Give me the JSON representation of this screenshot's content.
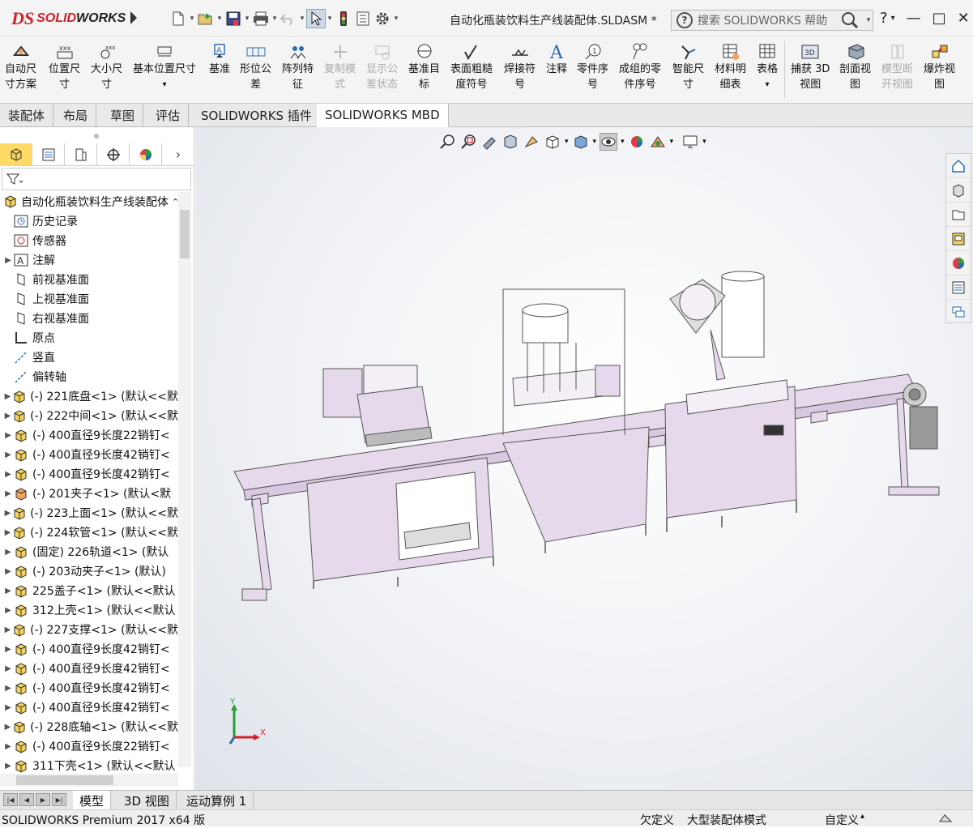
{
  "app": {
    "logo_prefix": "DS",
    "logo_text_red": "SOLID",
    "logo_text_dark": "WORKS"
  },
  "title": "自动化瓶装饮料生产线装配体.SLDASM *",
  "search": {
    "placeholder": "搜索 SOLIDWORKS 帮助"
  },
  "window_controls": {
    "help": "?",
    "minimize": "—",
    "maximize": "□",
    "close": "✕"
  },
  "commands": [
    {
      "label1": "自动尺",
      "label2": "寸方案",
      "icon": "auto-dimension-icon",
      "enabled": true
    },
    {
      "label1": "位置尺",
      "label2": "寸",
      "icon": "location-dimension-icon",
      "enabled": true
    },
    {
      "label1": "大小尺",
      "label2": "寸",
      "icon": "size-dimension-icon",
      "enabled": true
    },
    {
      "label1": "基本位置尺寸",
      "label2": "",
      "icon": "basic-location-dimension-icon",
      "enabled": true
    },
    {
      "label1": "基准",
      "label2": "",
      "icon": "datum-icon",
      "enabled": true
    },
    {
      "label1": "形位公",
      "label2": "差",
      "icon": "geometric-tolerance-icon",
      "enabled": true
    },
    {
      "label1": "阵列特",
      "label2": "征",
      "icon": "pattern-feature-icon",
      "enabled": true
    },
    {
      "label1": "复制模",
      "label2": "式",
      "icon": "copy-scheme-icon",
      "enabled": false
    },
    {
      "label1": "显示公",
      "label2": "差状态",
      "icon": "show-tolerance-status-icon",
      "enabled": false
    },
    {
      "label1": "基准目",
      "label2": "标",
      "icon": "datum-target-icon",
      "enabled": true
    },
    {
      "label1": "表面粗糙",
      "label2": "度符号",
      "icon": "surface-finish-icon",
      "enabled": true
    },
    {
      "label1": "焊接符",
      "label2": "号",
      "icon": "weld-symbol-icon",
      "enabled": true
    },
    {
      "label1": "注释",
      "label2": "",
      "icon": "note-icon",
      "enabled": true
    },
    {
      "label1": "零件序",
      "label2": "号",
      "icon": "balloon-icon",
      "enabled": true
    },
    {
      "label1": "成组的零",
      "label2": "件序号",
      "icon": "stacked-balloon-icon",
      "enabled": true
    },
    {
      "label1": "智能尺",
      "label2": "寸",
      "icon": "smart-dimension-icon",
      "enabled": true
    },
    {
      "label1": "材料明",
      "label2": "细表",
      "icon": "bom-icon",
      "enabled": true
    },
    {
      "label1": "表格",
      "label2": "",
      "icon": "table-icon",
      "enabled": true
    },
    {
      "label1": "捕获 3D",
      "label2": "视图",
      "icon": "capture-3d-view-icon",
      "enabled": true
    },
    {
      "label1": "剖面视",
      "label2": "图",
      "icon": "section-view-icon",
      "enabled": true
    },
    {
      "label1": "模型断",
      "label2": "开视图",
      "icon": "model-break-view-icon",
      "enabled": false
    },
    {
      "label1": "爆炸视",
      "label2": "图",
      "icon": "exploded-view-icon",
      "enabled": true
    }
  ],
  "tabs": [
    "装配体",
    "布局",
    "草图",
    "评估",
    "SOLIDWORKS 插件",
    "SOLIDWORKS MBD"
  ],
  "active_tab": "SOLIDWORKS MBD",
  "tree": {
    "root": "自动化瓶装饮料生产线装配体",
    "items": [
      {
        "label": "历史记录",
        "expandable": false,
        "icon": "history-icon"
      },
      {
        "label": "传感器",
        "expandable": false,
        "icon": "sensor-icon"
      },
      {
        "label": "注解",
        "expandable": true,
        "icon": "annotation-icon"
      },
      {
        "label": "前视基准面",
        "expandable": false,
        "icon": "plane-icon"
      },
      {
        "label": "上视基准面",
        "expandable": false,
        "icon": "plane-icon"
      },
      {
        "label": "右视基准面",
        "expandable": false,
        "icon": "plane-icon"
      },
      {
        "label": "原点",
        "expandable": false,
        "icon": "origin-icon"
      },
      {
        "label": "竖直",
        "expandable": false,
        "icon": "axis-icon"
      },
      {
        "label": "偏转轴",
        "expandable": false,
        "icon": "axis-icon"
      },
      {
        "label": "(-) 221底盘<1> (默认<<默",
        "expandable": true,
        "icon": "part-icon"
      },
      {
        "label": "(-) 222中间<1> (默认<<默",
        "expandable": true,
        "icon": "part-icon"
      },
      {
        "label": "(-) 400直径9长度22销钉<",
        "expandable": true,
        "icon": "part-icon"
      },
      {
        "label": "(-) 400直径9长度42销钉<",
        "expandable": true,
        "icon": "part-icon"
      },
      {
        "label": "(-) 400直径9长度42销钉<",
        "expandable": true,
        "icon": "part-icon"
      },
      {
        "label": "(-) 201夹子<1> (默认<默",
        "expandable": true,
        "icon": "subassembly-icon"
      },
      {
        "label": "(-) 223上面<1> (默认<<默",
        "expandable": true,
        "icon": "part-icon"
      },
      {
        "label": "(-) 224软管<1> (默认<<默",
        "expandable": true,
        "icon": "part-icon"
      },
      {
        "label": "(固定) 226轨道<1> (默认",
        "expandable": true,
        "icon": "part-icon"
      },
      {
        "label": "(-) 203动夹子<1> (默认)",
        "expandable": true,
        "icon": "part-icon"
      },
      {
        "label": "225盖子<1> (默认<<默认",
        "expandable": true,
        "icon": "part-icon"
      },
      {
        "label": "312上壳<1> (默认<<默认",
        "expandable": true,
        "icon": "part-icon"
      },
      {
        "label": "(-) 227支撑<1> (默认<<默",
        "expandable": true,
        "icon": "part-icon"
      },
      {
        "label": "(-) 400直径9长度42销钉<",
        "expandable": true,
        "icon": "part-icon"
      },
      {
        "label": "(-) 400直径9长度42销钉<",
        "expandable": true,
        "icon": "part-icon"
      },
      {
        "label": "(-) 400直径9长度42销钉<",
        "expandable": true,
        "icon": "part-icon"
      },
      {
        "label": "(-) 400直径9长度42销钉<",
        "expandable": true,
        "icon": "part-icon"
      },
      {
        "label": "(-) 228底轴<1> (默认<<默",
        "expandable": true,
        "icon": "part-icon"
      },
      {
        "label": "(-) 400直径9长度22销钉<",
        "expandable": true,
        "icon": "part-icon"
      },
      {
        "label": "311下壳<1> (默认<<默认",
        "expandable": true,
        "icon": "part-icon"
      }
    ]
  },
  "triad": {
    "x": "X",
    "y": "Y"
  },
  "bottom_tabs": [
    "模型",
    "3D 视图",
    "运动算例 1"
  ],
  "active_bottom_tab": "模型",
  "status": {
    "version": "SOLIDWORKS Premium 2017 x64 版",
    "state": "欠定义",
    "mode": "大型装配体模式",
    "units": "自定义"
  },
  "colors": {
    "brand": "#d0202a",
    "machine": "#e6d9ec",
    "machine_stroke": "#555555",
    "panel": "#f4f4f4"
  }
}
